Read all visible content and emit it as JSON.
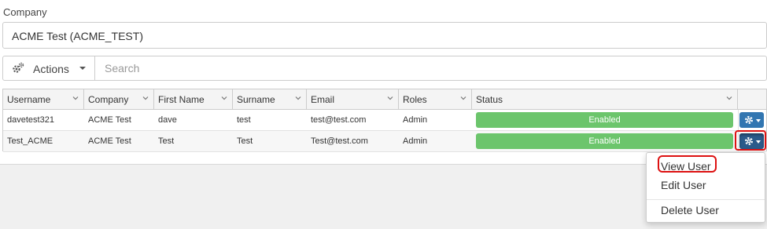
{
  "company": {
    "label": "Company",
    "value": "ACME Test (ACME_TEST)"
  },
  "toolbar": {
    "actions_label": "Actions",
    "search_placeholder": "Search"
  },
  "grid": {
    "columns": [
      "Username",
      "Company",
      "First Name",
      "Surname",
      "Email",
      "Roles",
      "Status"
    ],
    "rows": [
      {
        "username": "davetest321",
        "company": "ACME Test",
        "first_name": "dave",
        "surname": "test",
        "email": "test@test.com",
        "roles": "Admin",
        "status": "Enabled"
      },
      {
        "username": "Test_ACME",
        "company": "ACME Test",
        "first_name": "Test",
        "surname": "Test",
        "email": "Test@test.com",
        "roles": "Admin",
        "status": "Enabled"
      }
    ]
  },
  "row_menu": {
    "items": [
      "View User",
      "Edit User",
      "Delete User"
    ]
  },
  "colors": {
    "status_enabled": "#6cc56c",
    "button_primary": "#3276b1",
    "highlight": "#dd1111"
  },
  "icons": {
    "actions": "gears-icon",
    "row_action": "gear-icon",
    "column_filter": "chevron-down-icon"
  }
}
